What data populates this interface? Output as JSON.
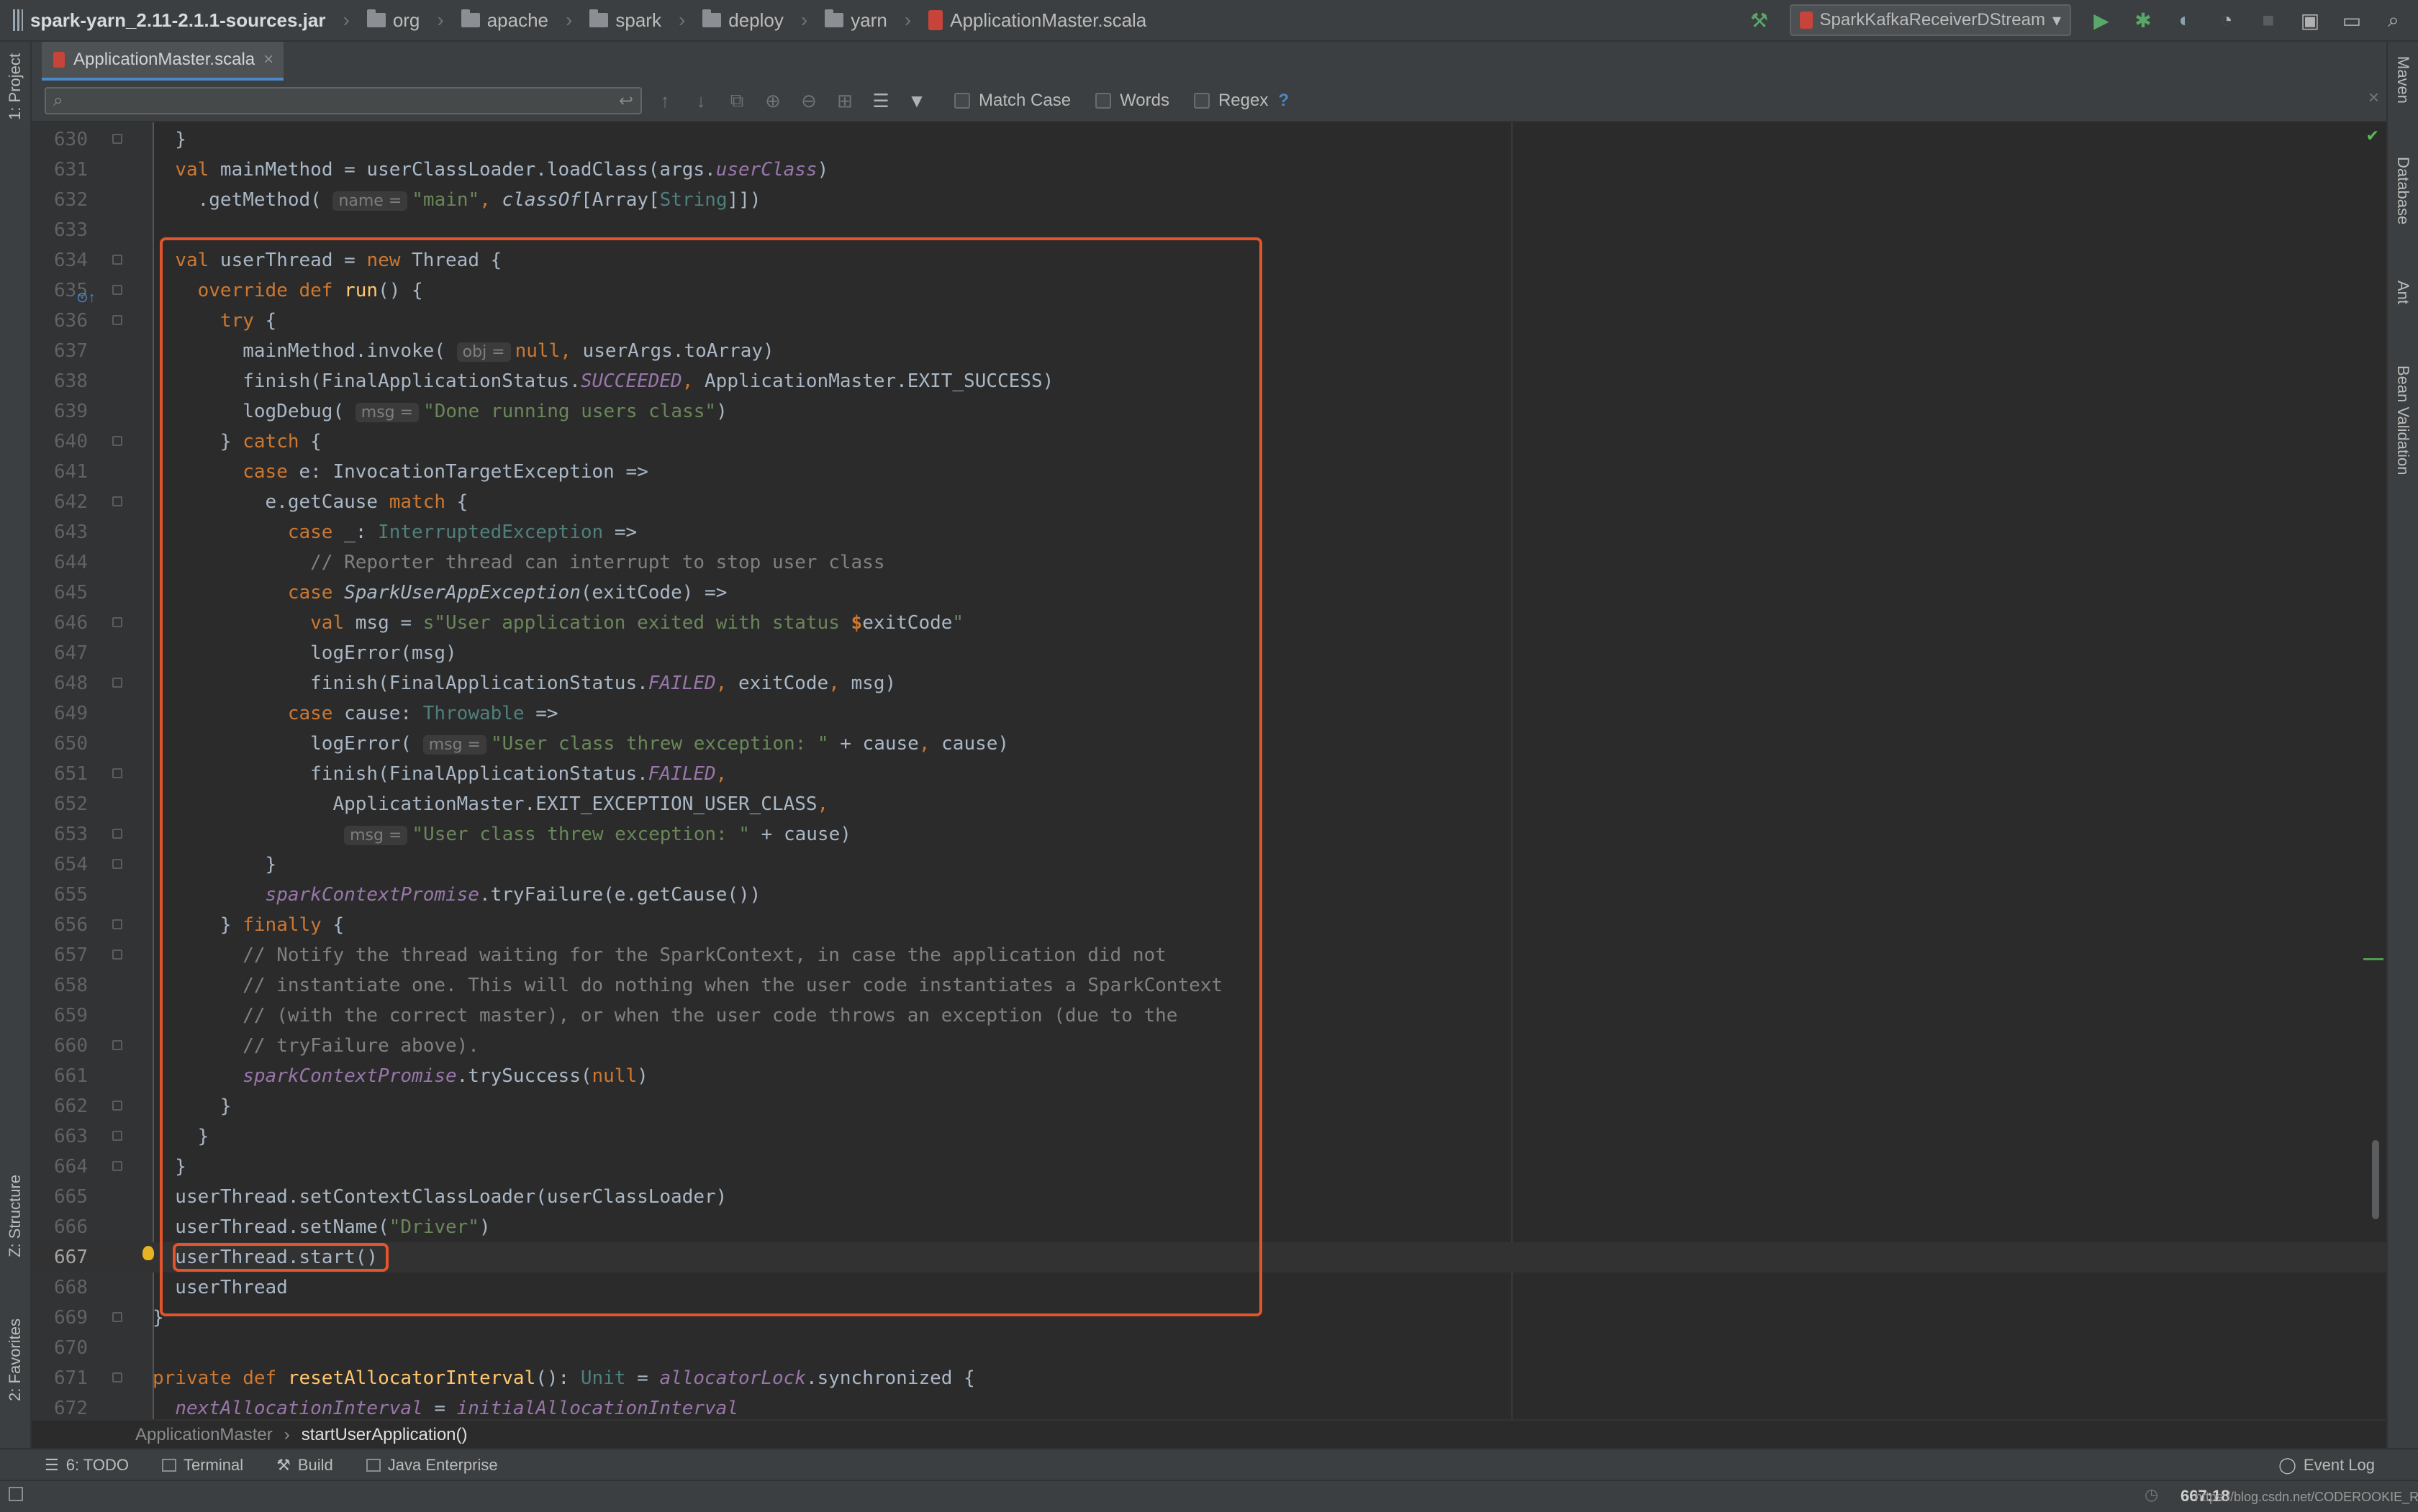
{
  "breadcrumb": {
    "items": [
      {
        "label": "spark-yarn_2.11-2.1.1-sources.jar",
        "icon": "jar-icon"
      },
      {
        "label": "org",
        "icon": "folder-icon"
      },
      {
        "label": "apache",
        "icon": "folder-icon"
      },
      {
        "label": "spark",
        "icon": "folder-icon"
      },
      {
        "label": "deploy",
        "icon": "folder-icon"
      },
      {
        "label": "yarn",
        "icon": "folder-icon"
      },
      {
        "label": "ApplicationMaster.scala",
        "icon": "scala-file-icon"
      }
    ]
  },
  "run_config": {
    "label": "SparkKafkaReceiverDStream"
  },
  "editor_tab": {
    "label": "ApplicationMaster.scala",
    "close": "×"
  },
  "find": {
    "match_case": "Match Case",
    "words": "Words",
    "regex": "Regex",
    "help": "?"
  },
  "left_tools": {
    "project": "1: Project",
    "structure": "Z: Structure",
    "favorites": "2: Favorites"
  },
  "right_tools": {
    "maven": "Maven",
    "database": "Database",
    "ant": "Ant",
    "bean": "Bean Validation"
  },
  "code_lines": [
    {
      "n": "630"
    },
    {
      "n": "631"
    },
    {
      "n": "632"
    },
    {
      "n": "633"
    },
    {
      "n": "634"
    },
    {
      "n": "635"
    },
    {
      "n": "636"
    },
    {
      "n": "637"
    },
    {
      "n": "638"
    },
    {
      "n": "639"
    },
    {
      "n": "640"
    },
    {
      "n": "641"
    },
    {
      "n": "642"
    },
    {
      "n": "643"
    },
    {
      "n": "644"
    },
    {
      "n": "645"
    },
    {
      "n": "646"
    },
    {
      "n": "647"
    },
    {
      "n": "648"
    },
    {
      "n": "649"
    },
    {
      "n": "650"
    },
    {
      "n": "651"
    },
    {
      "n": "652"
    },
    {
      "n": "653"
    },
    {
      "n": "654"
    },
    {
      "n": "655"
    },
    {
      "n": "656"
    },
    {
      "n": "657"
    },
    {
      "n": "658"
    },
    {
      "n": "659"
    },
    {
      "n": "660"
    },
    {
      "n": "661"
    },
    {
      "n": "662"
    },
    {
      "n": "663"
    },
    {
      "n": "664"
    },
    {
      "n": "665"
    },
    {
      "n": "666"
    },
    {
      "n": "667"
    },
    {
      "n": "668"
    },
    {
      "n": "669"
    },
    {
      "n": "670"
    },
    {
      "n": "671"
    },
    {
      "n": "672"
    }
  ],
  "code_breadcrumb": {
    "class": "ApplicationMaster",
    "method": "startUserApplication()"
  },
  "bottom_tools": {
    "todo": "6: TODO",
    "terminal": "Terminal",
    "build": "Build",
    "java_ee": "Java Enterprise",
    "event_log": "Event Log"
  },
  "status": {
    "position": "667:18",
    "watermark": "https://blog.csdn.net/CODEROOKIE_RUN"
  },
  "colors": {
    "keyword": "#cc7832",
    "string": "#6a8759",
    "comment": "#808080",
    "field": "#9876aa",
    "highlight_box": "#e4542b",
    "background": "#2b2b2b"
  }
}
